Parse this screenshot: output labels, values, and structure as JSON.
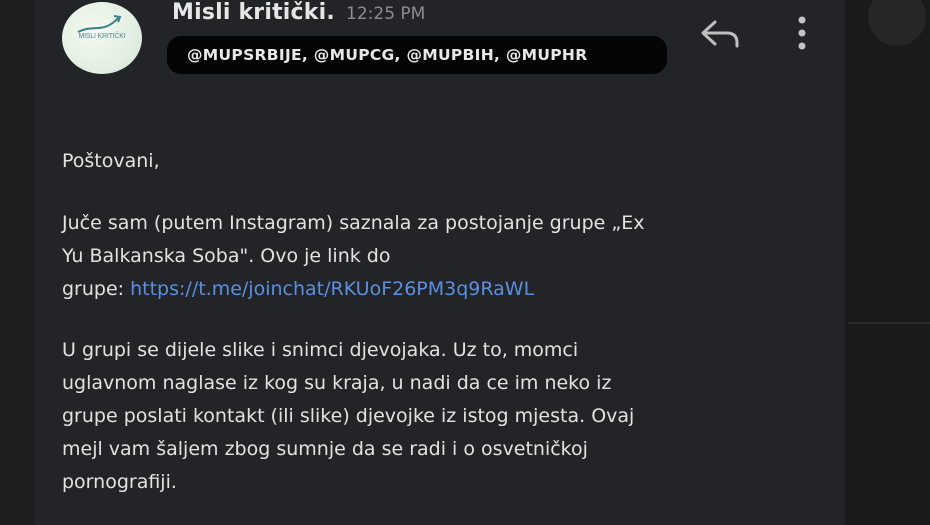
{
  "email": {
    "sender_name": "Misli kritički.",
    "time": "12:25 PM",
    "avatar_text": "MISLI KRITIČKI",
    "recipients": "@MUPSRBIJE, @MUPCG, @MUPBIH, @MUPHR"
  },
  "icons": {
    "reply": "reply-arrow",
    "more": "vertical-ellipsis"
  },
  "body": {
    "greeting": "Poštovani,",
    "p2_line1": "Juče sam (putem Instagram) saznala za postojanje grupe „Ex",
    "p2_line2": "Yu Balkanska Soba\". Ovo je link do",
    "p2_line3_prefix": "grupe: ",
    "link": "https://t.me/joinchat/RKUoF26PM3q9RaWL",
    "p3_line1": "U grupi se dijele slike i snimci djevojaka. Uz to, momci",
    "p3_line2": "uglavnom naglase iz kog su kraja, u nadi da ce im neko iz",
    "p3_line3": "grupe poslati kontakt (ili slike) djevojke iz istog mjesta. Ovaj",
    "p3_line4": "mejl vam šaljem zbog sumnje da se radi i o osvetničkoj",
    "p3_line5": "pornografiji."
  },
  "colors": {
    "background": "#232427",
    "text": "#e2e2e2",
    "link": "#5b8fe0",
    "pill": "#050505"
  }
}
